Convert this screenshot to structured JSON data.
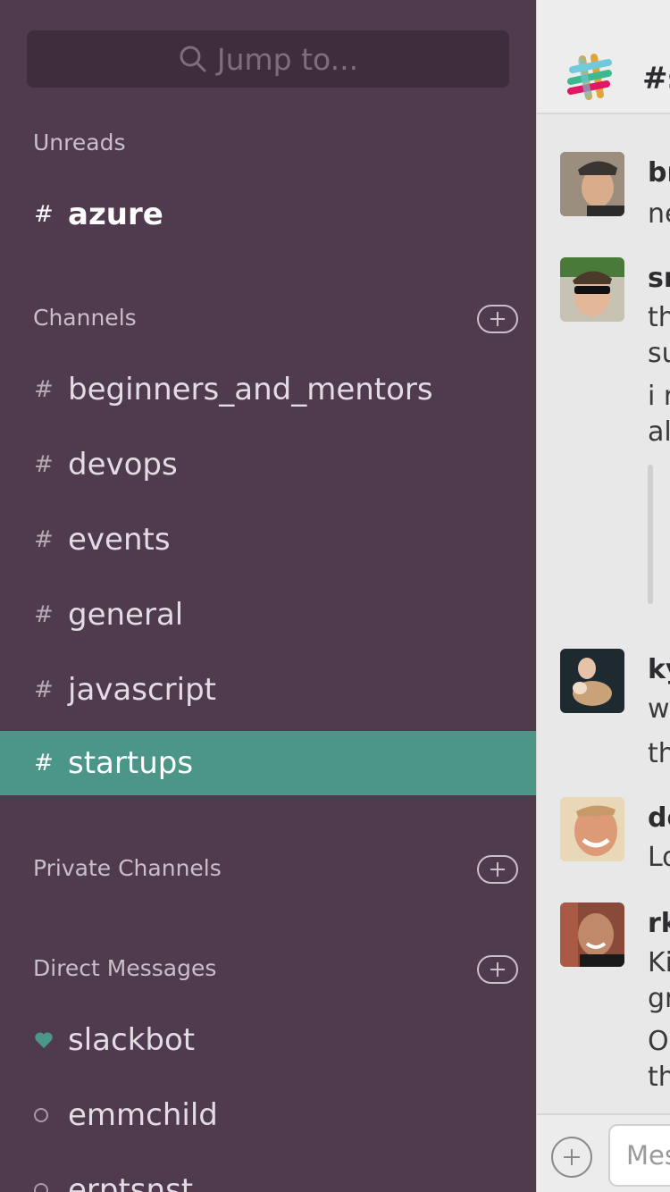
{
  "search": {
    "placeholder": "Jump to..."
  },
  "sidebar": {
    "unreads_header": "Unreads",
    "unreads": [
      {
        "hash": "#",
        "name": "azure"
      }
    ],
    "channels_header": "Channels",
    "channels": [
      {
        "hash": "#",
        "name": "beginners_and_mentors"
      },
      {
        "hash": "#",
        "name": "devops"
      },
      {
        "hash": "#",
        "name": "events"
      },
      {
        "hash": "#",
        "name": "general"
      },
      {
        "hash": "#",
        "name": "javascript"
      },
      {
        "hash": "#",
        "name": "startups",
        "active": true
      }
    ],
    "private_header": "Private Channels",
    "dm_header": "Direct Messages",
    "dms": [
      {
        "name": "slackbot",
        "icon": "heart-icon"
      },
      {
        "name": "emmchild",
        "icon": "presence-away-icon"
      },
      {
        "name": "erptsnst",
        "icon": "presence-away-icon"
      }
    ]
  },
  "panel": {
    "title": "#s",
    "messages": [
      {
        "name": "br",
        "lines": [
          "ne"
        ]
      },
      {
        "name": "sr",
        "lines": [
          "th",
          "su",
          "i r",
          "all"
        ]
      },
      {
        "name": "ky",
        "lines": [
          "w",
          "th"
        ]
      },
      {
        "name": "de",
        "lines": [
          "Lo"
        ]
      },
      {
        "name": "rk",
        "lines": [
          "Ki",
          "gr",
          "O",
          "th"
        ]
      }
    ],
    "composer_placeholder": "Mes"
  },
  "colors": {
    "sidebar_bg": "#4f3a4e",
    "active_channel": "#4b9589",
    "presence_heart": "#4b9589"
  }
}
